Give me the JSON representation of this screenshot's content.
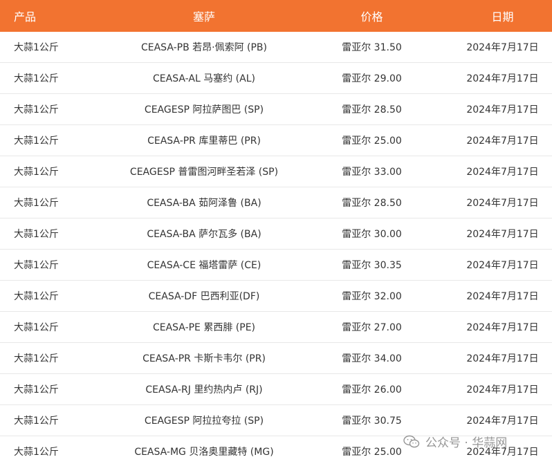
{
  "table": {
    "headers": [
      "产品",
      "塞萨",
      "价格",
      "日期"
    ],
    "rows": [
      {
        "product": "大蒜1公斤",
        "market": "CEASA-PB 若昂·佩索阿 (PB)",
        "price": "雷亚尔 31.50",
        "date": "2024年7月17日"
      },
      {
        "product": "大蒜1公斤",
        "market": "CEASA-AL 马塞约 (AL)",
        "price": "雷亚尔 29.00",
        "date": "2024年7月17日"
      },
      {
        "product": "大蒜1公斤",
        "market": "CEAGESP 阿拉萨图巴 (SP)",
        "price": "雷亚尔 28.50",
        "date": "2024年7月17日"
      },
      {
        "product": "大蒜1公斤",
        "market": "CEASA-PR 库里蒂巴 (PR)",
        "price": "雷亚尔 25.00",
        "date": "2024年7月17日"
      },
      {
        "product": "大蒜1公斤",
        "market": "CEAGESP 普雷图河畔圣若泽 (SP)",
        "price": "雷亚尔 33.00",
        "date": "2024年7月17日"
      },
      {
        "product": "大蒜1公斤",
        "market": "CEASA-BA 茹阿泽鲁 (BA)",
        "price": "雷亚尔 28.50",
        "date": "2024年7月17日"
      },
      {
        "product": "大蒜1公斤",
        "market": "CEASA-BA 萨尔瓦多 (BA)",
        "price": "雷亚尔 30.00",
        "date": "2024年7月17日"
      },
      {
        "product": "大蒜1公斤",
        "market": "CEASA-CE 福塔雷萨 (CE)",
        "price": "雷亚尔 30.35",
        "date": "2024年7月17日"
      },
      {
        "product": "大蒜1公斤",
        "market": "CEASA-DF 巴西利亚(DF)",
        "price": "雷亚尔 32.00",
        "date": "2024年7月17日"
      },
      {
        "product": "大蒜1公斤",
        "market": "CEASA-PE 累西腓 (PE)",
        "price": "雷亚尔 27.00",
        "date": "2024年7月17日"
      },
      {
        "product": "大蒜1公斤",
        "market": "CEASA-PR 卡斯卡韦尔 (PR)",
        "price": "雷亚尔 34.00",
        "date": "2024年7月17日"
      },
      {
        "product": "大蒜1公斤",
        "market": "CEASA-RJ 里约热内卢 (RJ)",
        "price": "雷亚尔 26.00",
        "date": "2024年7月17日"
      },
      {
        "product": "大蒜1公斤",
        "market": "CEAGESP 阿拉拉夸拉 (SP)",
        "price": "雷亚尔 30.75",
        "date": "2024年7月17日"
      },
      {
        "product": "大蒜1公斤",
        "market": "CEASA-MG 贝洛奥里藏特 (MG)",
        "price": "雷亚尔 25.00",
        "date": "2024年7月17日"
      }
    ]
  },
  "watermark": {
    "text": "公众号 · 华蒜网",
    "icon": "wechat-icon"
  },
  "colors": {
    "header_bg": "#f27330",
    "header_text": "#ffffff",
    "row_divider": "#e8e8e8"
  }
}
